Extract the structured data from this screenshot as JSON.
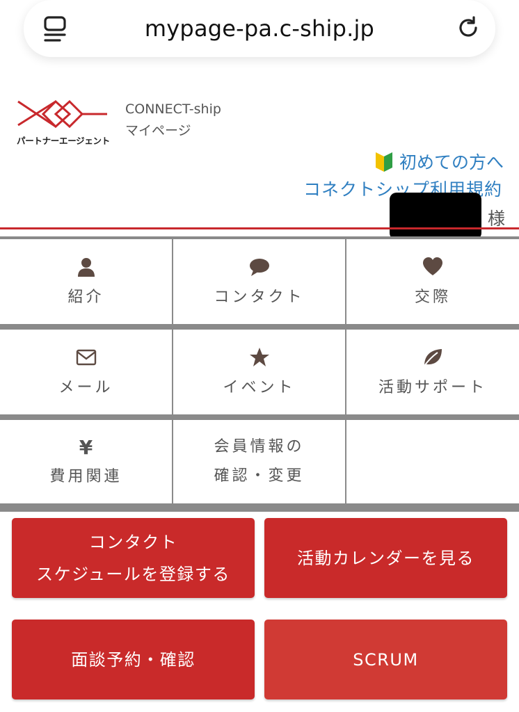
{
  "browser": {
    "url": "mypage-pa.c-ship.jp"
  },
  "header": {
    "logo_text": "パートナーエージェント",
    "brand_line1": "CONNECT-ship",
    "brand_line2": "マイページ",
    "link_first_time": "初めての方へ",
    "link_terms": "コネクトシップ利用規約",
    "honorific": "様"
  },
  "menu": {
    "items": [
      {
        "label": "紹介",
        "icon": "user-icon"
      },
      {
        "label": "コンタクト",
        "icon": "speech-bubble-icon"
      },
      {
        "label": "交際",
        "icon": "heart-icon"
      },
      {
        "label": "メール",
        "icon": "envelope-icon"
      },
      {
        "label": "イベント",
        "icon": "star-icon"
      },
      {
        "label": "活動サポート",
        "icon": "leaf-icon"
      },
      {
        "label": "費用関連",
        "icon": "yen-icon",
        "symbol": "¥"
      },
      {
        "label_line1": "会員情報の",
        "label_line2": "確認・変更"
      }
    ]
  },
  "buttons": {
    "contact_schedule_line1": "コンタクト",
    "contact_schedule_line2": "スケジュールを登録する",
    "calendar": "活動カレンダーを見る",
    "interview": "面談予約・確認",
    "scrum": "SCRUM"
  },
  "colors": {
    "brand_red": "#c92a2a",
    "link_blue": "#2f7fc1",
    "grid_gray": "#8a8a8a",
    "text_gray": "#555555"
  }
}
